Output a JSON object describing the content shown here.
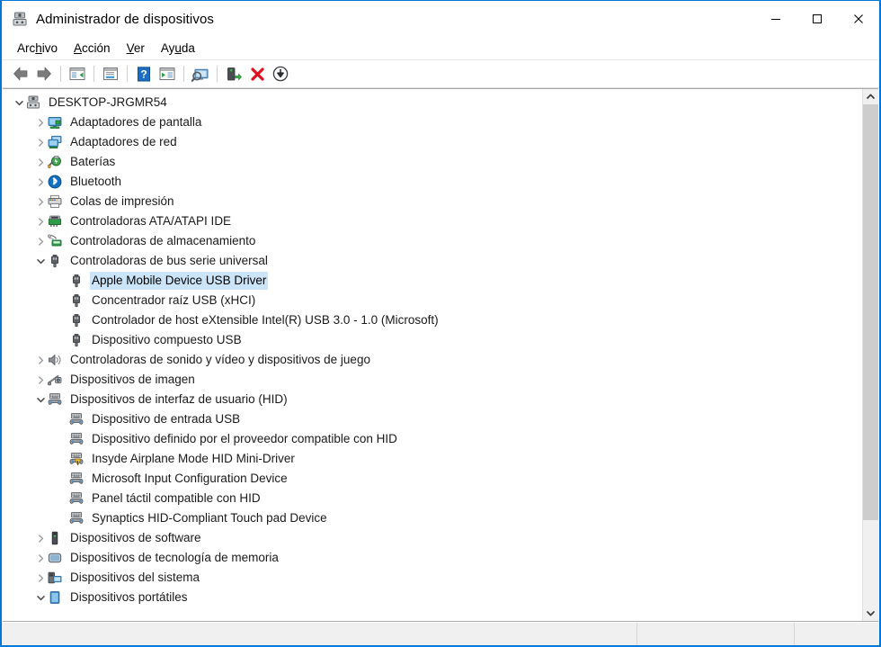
{
  "window": {
    "title": "Administrador de dispositivos",
    "title_icon": "device-manager-icon",
    "controls": {
      "minimize": "—",
      "maximize": "☐",
      "close": "✕",
      "minimize_name": "minimize-button",
      "maximize_name": "maximize-button",
      "close_name": "close-button"
    },
    "accent_color": "#0078d7",
    "selection_color": "#cce4f7"
  },
  "menu": {
    "items": [
      {
        "label": "Archivo",
        "pre": "Arc",
        "key": "h",
        "post": "ivo"
      },
      {
        "label": "Acción",
        "pre": "",
        "key": "A",
        "post": "cción"
      },
      {
        "label": "Ver",
        "pre": "",
        "key": "V",
        "post": "er"
      },
      {
        "label": "Ayuda",
        "pre": "Ay",
        "key": "u",
        "post": "da"
      }
    ]
  },
  "toolbar": {
    "buttons": [
      {
        "name": "back-button",
        "icon": "left-arrow-icon",
        "tooltip": "Atrás"
      },
      {
        "name": "forward-button",
        "icon": "right-arrow-icon",
        "tooltip": "Adelante"
      },
      {
        "name": "separator-1",
        "icon": "separator"
      },
      {
        "name": "show-hide-console-tree-button",
        "icon": "console-tree-icon",
        "tooltip": "Mostrar/ocultar árbol de consola"
      },
      {
        "name": "separator-2",
        "icon": "separator"
      },
      {
        "name": "properties-button",
        "icon": "properties-icon",
        "tooltip": "Propiedades"
      },
      {
        "name": "separator-3",
        "icon": "separator"
      },
      {
        "name": "help-button",
        "icon": "help-question-icon",
        "tooltip": "Ayuda"
      },
      {
        "name": "action-menu-button",
        "icon": "action-window-icon",
        "tooltip": "Acción"
      },
      {
        "name": "separator-4",
        "icon": "separator"
      },
      {
        "name": "scan-hardware-changes-button",
        "icon": "monitor-scan-icon",
        "tooltip": "Buscar cambios de hardware"
      },
      {
        "name": "separator-5",
        "icon": "separator"
      },
      {
        "name": "update-driver-button",
        "icon": "update-driver-icon",
        "tooltip": "Actualizar controlador"
      },
      {
        "name": "uninstall-device-button",
        "icon": "red-x-icon",
        "tooltip": "Desinstalar el dispositivo"
      },
      {
        "name": "disable-device-button",
        "icon": "disable-down-arrow-icon",
        "tooltip": "Deshabilitar dispositivo"
      }
    ]
  },
  "tree": {
    "rows": [
      {
        "label": "DESKTOP-JRGMR54",
        "level": 0,
        "state": "expanded",
        "icon": "computer-icon",
        "selected": false
      },
      {
        "label": "Adaptadores de pantalla",
        "level": 1,
        "state": "collapsed",
        "icon": "display-adapter-icon",
        "selected": false
      },
      {
        "label": "Adaptadores de red",
        "level": 1,
        "state": "collapsed",
        "icon": "network-adapter-icon",
        "selected": false
      },
      {
        "label": "Baterías",
        "level": 1,
        "state": "collapsed",
        "icon": "battery-icon",
        "selected": false
      },
      {
        "label": "Bluetooth",
        "level": 1,
        "state": "collapsed",
        "icon": "bluetooth-icon",
        "selected": false
      },
      {
        "label": "Colas de impresión",
        "level": 1,
        "state": "collapsed",
        "icon": "printer-icon",
        "selected": false
      },
      {
        "label": "Controladoras ATA/ATAPI IDE",
        "level": 1,
        "state": "collapsed",
        "icon": "ide-controller-icon",
        "selected": false
      },
      {
        "label": "Controladoras de almacenamiento",
        "level": 1,
        "state": "collapsed",
        "icon": "storage-controller-icon",
        "selected": false
      },
      {
        "label": "Controladoras de bus serie universal",
        "level": 1,
        "state": "expanded",
        "icon": "usb-icon",
        "selected": false
      },
      {
        "label": "Apple Mobile Device USB Driver",
        "level": 2,
        "state": "leaf",
        "icon": "usb-icon",
        "selected": true
      },
      {
        "label": "Concentrador raíz USB (xHCI)",
        "level": 2,
        "state": "leaf",
        "icon": "usb-icon",
        "selected": false
      },
      {
        "label": "Controlador de host eXtensible Intel(R) USB 3.0 - 1.0 (Microsoft)",
        "level": 2,
        "state": "leaf",
        "icon": "usb-icon",
        "selected": false
      },
      {
        "label": "Dispositivo compuesto USB",
        "level": 2,
        "state": "leaf",
        "icon": "usb-icon",
        "selected": false
      },
      {
        "label": "Controladoras de sonido y vídeo y dispositivos de juego",
        "level": 1,
        "state": "collapsed",
        "icon": "speaker-icon",
        "selected": false
      },
      {
        "label": "Dispositivos de imagen",
        "level": 1,
        "state": "collapsed",
        "icon": "camera-icon",
        "selected": false
      },
      {
        "label": "Dispositivos de interfaz de usuario (HID)",
        "level": 1,
        "state": "expanded",
        "icon": "hid-icon",
        "selected": false
      },
      {
        "label": "Dispositivo de entrada USB",
        "level": 2,
        "state": "leaf",
        "icon": "hid-icon",
        "selected": false
      },
      {
        "label": "Dispositivo definido por el proveedor compatible con HID",
        "level": 2,
        "state": "leaf",
        "icon": "hid-icon",
        "selected": false
      },
      {
        "label": "Insyde Airplane Mode HID Mini-Driver",
        "level": 2,
        "state": "leaf",
        "icon": "hid-warning-icon",
        "selected": false
      },
      {
        "label": "Microsoft Input Configuration Device",
        "level": 2,
        "state": "leaf",
        "icon": "hid-icon",
        "selected": false
      },
      {
        "label": "Panel táctil compatible con HID",
        "level": 2,
        "state": "leaf",
        "icon": "hid-icon",
        "selected": false
      },
      {
        "label": "Synaptics HID-Compliant Touch pad Device",
        "level": 2,
        "state": "leaf",
        "icon": "hid-icon",
        "selected": false
      },
      {
        "label": "Dispositivos de software",
        "level": 1,
        "state": "collapsed",
        "icon": "software-device-icon",
        "selected": false
      },
      {
        "label": "Dispositivos de tecnología de memoria",
        "level": 1,
        "state": "collapsed",
        "icon": "memory-tech-icon",
        "selected": false
      },
      {
        "label": "Dispositivos del sistema",
        "level": 1,
        "state": "collapsed",
        "icon": "system-device-icon",
        "selected": false
      },
      {
        "label": "Dispositivos portátiles",
        "level": 1,
        "state": "expanded",
        "icon": "portable-device-icon",
        "selected": false
      }
    ]
  },
  "scrollbar": {
    "up_arrow": "▲",
    "down_arrow": "▼",
    "thumb_top_percent": 0,
    "thumb_height_percent": 83
  },
  "statusbar": {
    "pane1": "",
    "pane2": "",
    "pane3": ""
  }
}
